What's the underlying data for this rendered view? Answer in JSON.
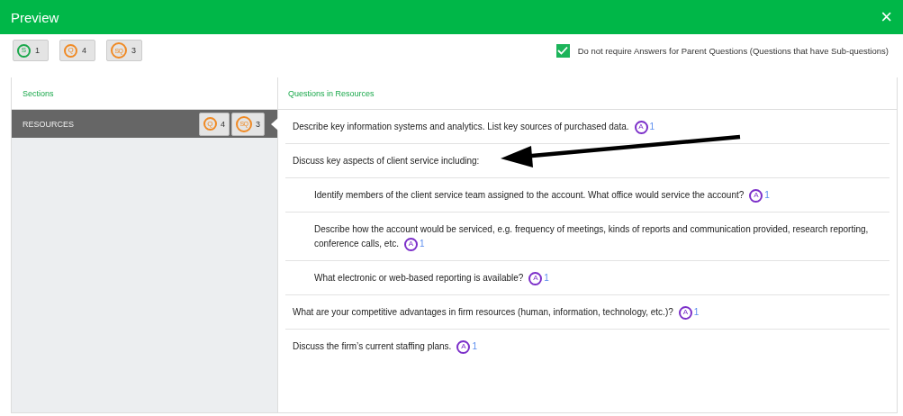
{
  "window": {
    "title": "Preview",
    "close": "×"
  },
  "counters": [
    {
      "letter": "S",
      "count": "1",
      "color": "#1aa84b"
    },
    {
      "letter": "Q",
      "count": "4",
      "color": "#f08a24"
    },
    {
      "letter": "SQ",
      "count": "3",
      "color": "#f08a24"
    }
  ],
  "option": {
    "label": "Do not require Answers for Parent Questions (Questions that have Sub-questions)",
    "checked": true
  },
  "sidebar": {
    "heading": "Sections",
    "items": [
      {
        "label": "RESOURCES",
        "selected": true,
        "badges": [
          {
            "letter": "Q",
            "count": "4"
          },
          {
            "letter": "SQ",
            "count": "3"
          }
        ]
      }
    ]
  },
  "questions_panel": {
    "heading": "Questions in Resources",
    "questions": [
      {
        "text": "Describe key information systems and analytics. List key sources of purchased data.",
        "answer": {
          "letter": "A",
          "count": "1"
        }
      },
      {
        "text": "Discuss key aspects of client service including:",
        "children": [
          {
            "text": "Identify members of the client service team assigned to the account. What office would service the account?",
            "answer": {
              "letter": "A",
              "count": "1"
            }
          },
          {
            "text": "Describe how the account would be serviced, e.g. frequency of meetings, kinds of reports and communication provided, research reporting, conference calls, etc.",
            "answer": {
              "letter": "A",
              "count": "1"
            }
          },
          {
            "text": "What electronic or web-based reporting is available?",
            "answer": {
              "letter": "A",
              "count": "1"
            }
          }
        ]
      },
      {
        "text": "What are your competitive advantages in firm resources (human, information, technology, etc.)?",
        "answer": {
          "letter": "A",
          "count": "1"
        }
      },
      {
        "text": "Discuss the firm’s current staffing plans.",
        "answer": {
          "letter": "A",
          "count": "1"
        }
      }
    ]
  }
}
